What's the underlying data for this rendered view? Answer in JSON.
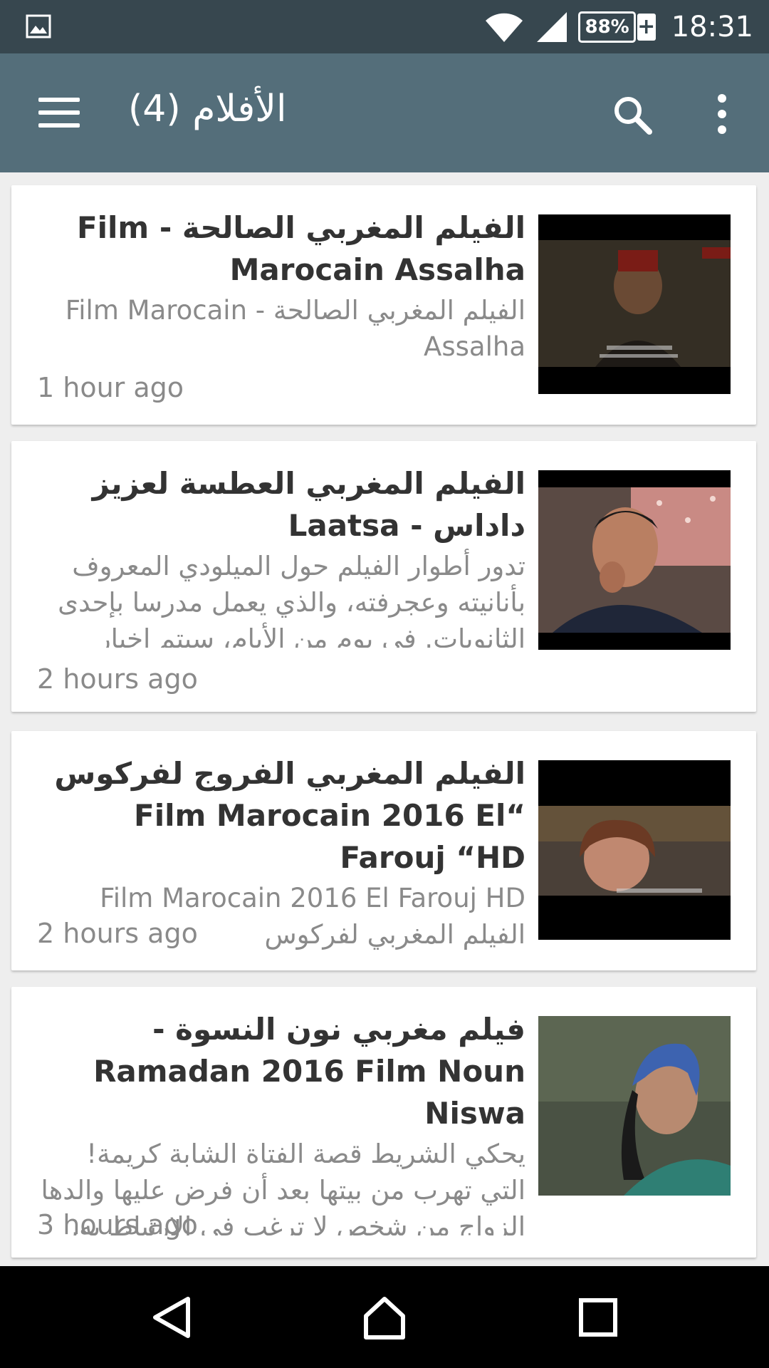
{
  "status_bar": {
    "battery_percent": "88%",
    "battery_plus": "+",
    "time": "18:31",
    "icons": [
      "gallery-notification-icon",
      "wifi-icon",
      "cellular-signal-icon",
      "battery-icon"
    ]
  },
  "app_bar": {
    "title": "الأفلام (4)",
    "icons": [
      "menu-icon",
      "search-icon",
      "more-vert-icon"
    ]
  },
  "videos": [
    {
      "title": "الفيلم المغربي الصالحة - Film Marocain Assalha",
      "description": "الفيلم المغربي الصالحة - Film Marocain Assalha",
      "time": "1 hour ago"
    },
    {
      "title": "الفيلم المغربي العطسة لعزيز داداس - Laatsa",
      "description": "تدور أطوار الفيلم حول الميلودي المعروف بأنانيته وعجرفته، والذي يعمل مدرسا بإحدى الثانويات. في يوم من الأيام، سيتم إخبار",
      "time": "2 hours ago"
    },
    {
      "title": "الفيلم المغربي الفروج لفركوس “Film Marocain 2016 El Farouj “HD",
      "description": "Film Marocain 2016 El Farouj HD الفيلم المغربي لفركوس",
      "time": "2 hours ago"
    },
    {
      "title": "فيلم مغربي نون النسوة - Ramadan 2016 Film Noun Niswa",
      "description": "يحكي الشريط قصة الفتاة الشابة كريمة! التي تهرب من بيتها بعد أن فرض عليها والدها الزواج من شخص لا ترغب في الإرتباط به,",
      "time": "3 hours ago"
    }
  ],
  "nav_bar": {
    "icons": [
      "back-icon",
      "home-icon",
      "recents-icon"
    ]
  },
  "colors": {
    "status_bar": "#37474f",
    "app_bar": "#546e7a",
    "background": "#eeeeee",
    "title_text": "#333333",
    "secondary_text": "#8a8a8a"
  }
}
